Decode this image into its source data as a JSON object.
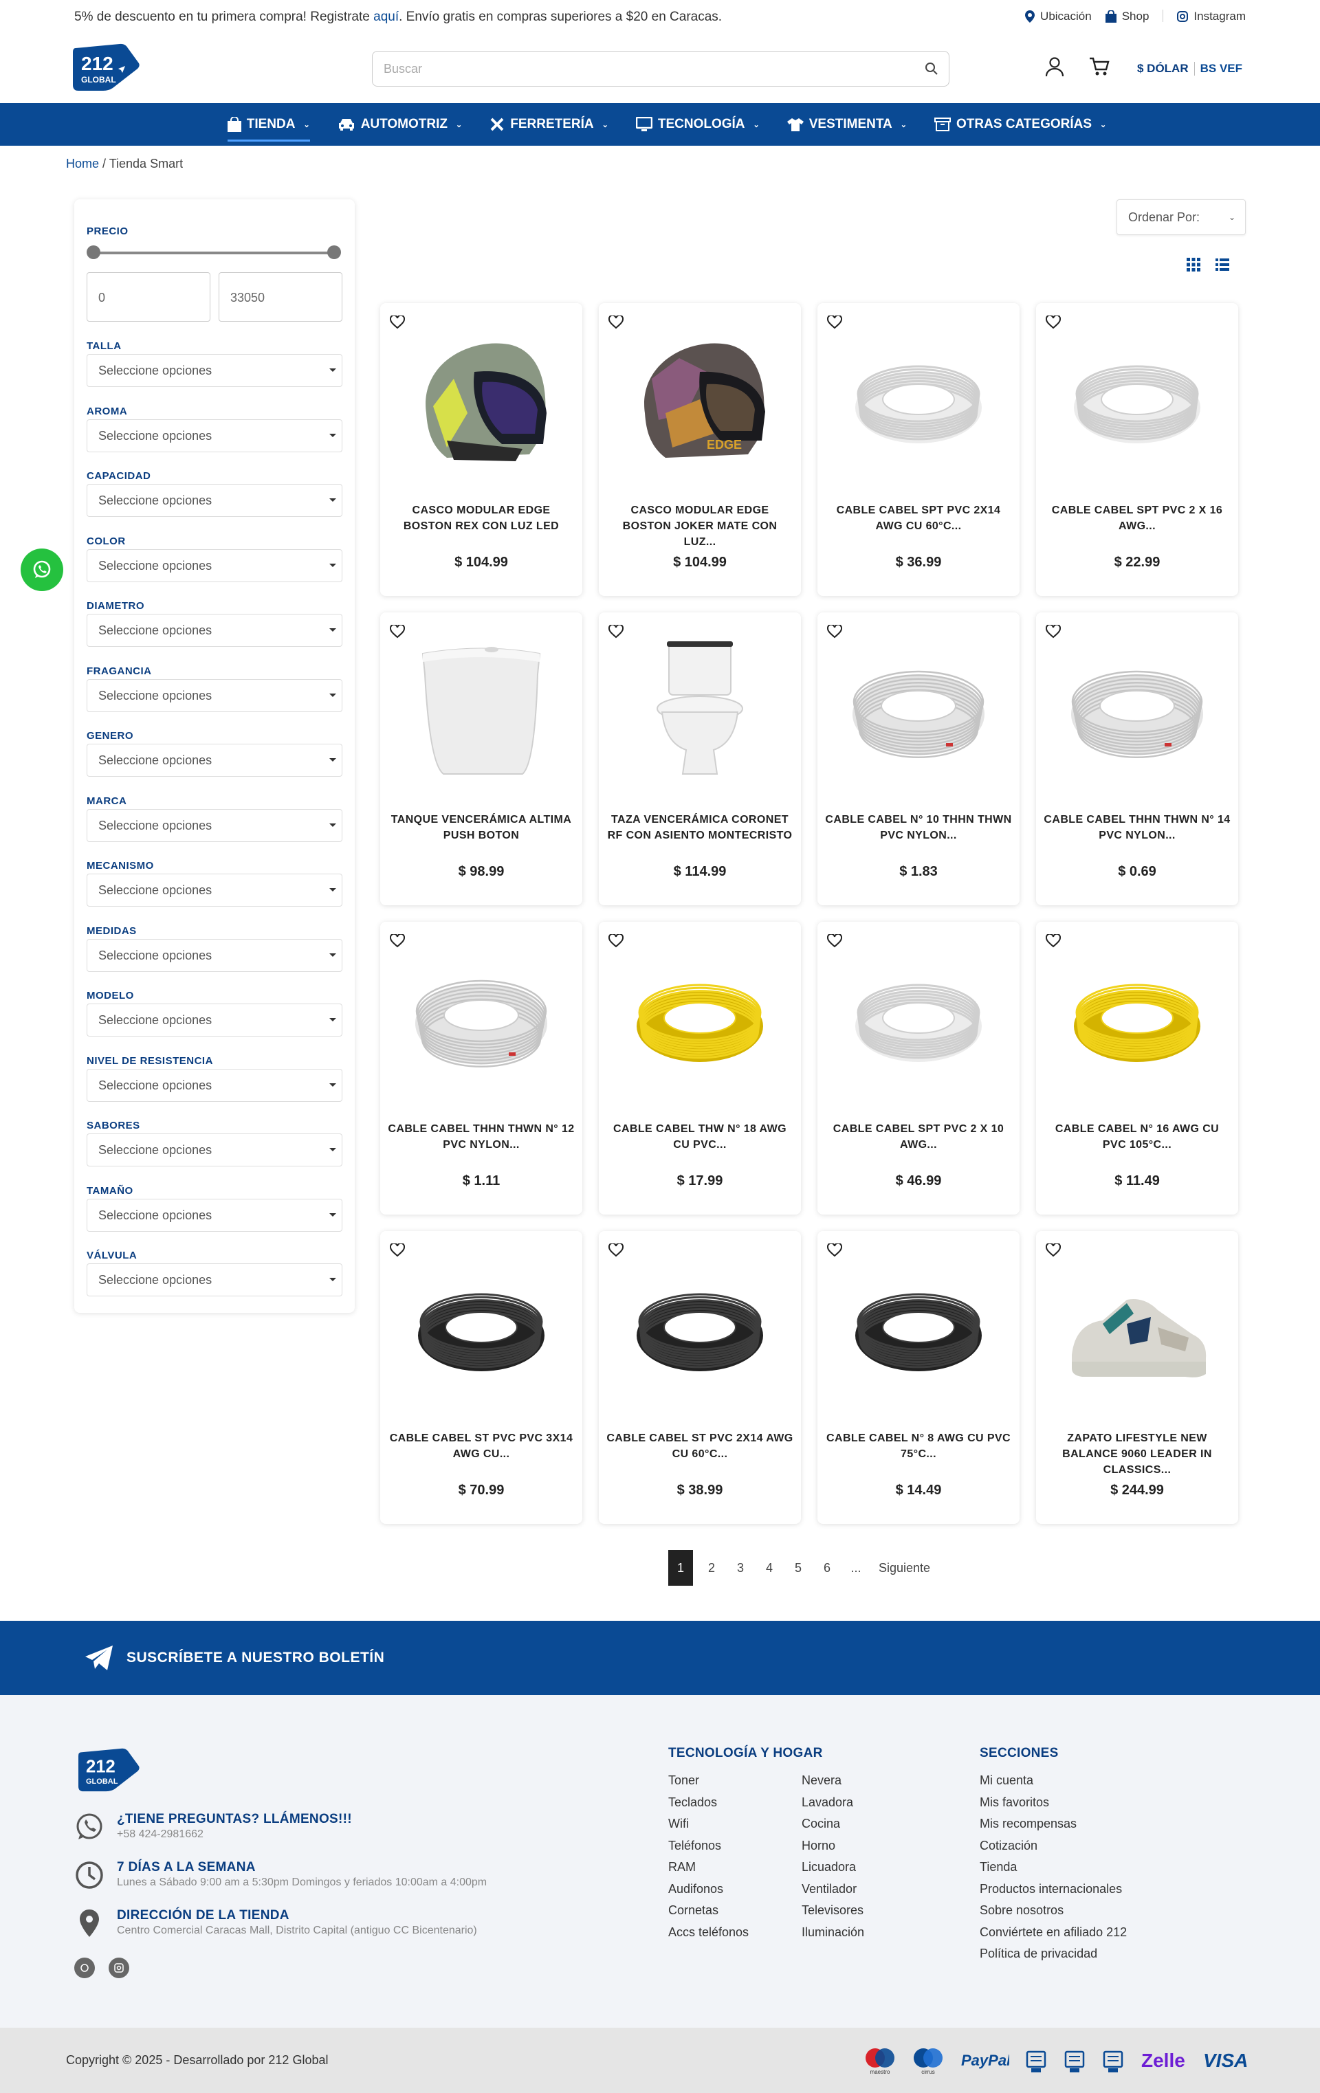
{
  "topbar": {
    "promo_before": "5% de descuento en tu primera compra! Registrate ",
    "promo_link": "aquí",
    "promo_after": ". Envío gratis en compras superiores a $20 en Caracas.",
    "links": [
      "Ubicación",
      "Shop",
      "Instagram"
    ]
  },
  "header": {
    "logo_text": "212",
    "logo_sub": "GLOBAL",
    "search_placeholder": "Buscar",
    "currency_active": "$ DÓLAR",
    "currency_alt": "BS VEF"
  },
  "nav": {
    "items": [
      "TIENDA",
      "AUTOMOTRIZ",
      "FERRETERÍA",
      "TECNOLOGÍA",
      "VESTIMENTA",
      "OTRAS CATEGORÍAS"
    ]
  },
  "breadcrumb": {
    "home": "Home",
    "sep": " / ",
    "current": "Tienda Smart"
  },
  "filters": {
    "price_title": "PRECIO",
    "price_min": "0",
    "price_max": "33050",
    "placeholder": "Seleccione opciones",
    "groups": [
      "TALLA",
      "AROMA",
      "CAPACIDAD",
      "COLOR",
      "DIAMETRO",
      "FRAGANCIA",
      "GENERO",
      "MARCA",
      "MECANISMO",
      "MEDIDAS",
      "MODELO",
      "NIVEL DE RESISTENCIA",
      "SABORES",
      "TAMAÑO",
      "VÁLVULA"
    ]
  },
  "sort": {
    "label": "Ordenar Por:"
  },
  "products": [
    {
      "name": "CASCO MODULAR EDGE BOSTON REX CON LUZ LED",
      "price": "$ 104.99",
      "img": "helmet-green"
    },
    {
      "name": "CASCO MODULAR EDGE BOSTON JOKER MATE CON LUZ...",
      "price": "$ 104.99",
      "img": "helmet-joker"
    },
    {
      "name": "CABLE CABEL SPT PVC 2X14 AWG CU 60°C...",
      "price": "$ 36.99",
      "img": "cable-white"
    },
    {
      "name": "CABLE CABEL SPT PVC 2 X 16 AWG...",
      "price": "$ 22.99",
      "img": "cable-white"
    },
    {
      "name": "TANQUE VENCERÁMICA ALTIMA PUSH BOTON",
      "price": "$ 98.99",
      "img": "tank"
    },
    {
      "name": "TAZA VENCERÁMICA CORONET RF CON ASIENTO MONTECRISTO",
      "price": "$ 114.99",
      "img": "toilet"
    },
    {
      "name": "CABLE CABEL N° 10 THHN THWN PVC NYLON...",
      "price": "$ 1.83",
      "img": "cable-flat"
    },
    {
      "name": "CABLE CABEL THHN THWN N° 14 PVC NYLON...",
      "price": "$ 0.69",
      "img": "cable-flat"
    },
    {
      "name": "CABLE CABEL THHN THWN N° 12 PVC NYLON...",
      "price": "$ 1.11",
      "img": "cable-flat"
    },
    {
      "name": "CABLE CABEL THW N° 18 AWG CU PVC...",
      "price": "$ 17.99",
      "img": "cable-yellow"
    },
    {
      "name": "CABLE CABEL SPT PVC 2 X 10 AWG...",
      "price": "$ 46.99",
      "img": "cable-white"
    },
    {
      "name": "CABLE CABEL N° 16 AWG CU PVC 105°C...",
      "price": "$ 11.49",
      "img": "cable-yellow"
    },
    {
      "name": "CABLE CABEL ST PVC PVC 3X14 AWG CU...",
      "price": "$ 70.99",
      "img": "cable-black"
    },
    {
      "name": "CABLE CABEL ST PVC 2X14 AWG CU 60°C...",
      "price": "$ 38.99",
      "img": "cable-black"
    },
    {
      "name": "CABLE CABEL N° 8 AWG CU PVC 75°C...",
      "price": "$ 14.49",
      "img": "cable-black"
    },
    {
      "name": "ZAPATO LIFESTYLE NEW BALANCE 9060 LEADER IN CLASSICS...",
      "price": "$ 244.99",
      "img": "shoe"
    }
  ],
  "pagination": {
    "pages": [
      "1",
      "2",
      "3",
      "4",
      "5",
      "6",
      "..."
    ],
    "next": "Siguiente"
  },
  "newsletter": {
    "text": "SUSCRÍBETE A NUESTRO BOLETÍN"
  },
  "footer": {
    "contact": [
      {
        "title": "¿TIENE PREGUNTAS? LLÁMENOS!!!",
        "sub": "+58 424-2981662"
      },
      {
        "title": "7 DÍAS A LA SEMANA",
        "sub": "Lunes a Sábado 9:00 am a 5:30pm Domingos y feriados 10:00am a 4:00pm"
      },
      {
        "title": "DIRECCIÓN DE LA TIENDA",
        "sub": "Centro Comercial Caracas Mall, Distrito Capital (antiguo CC Bicentenario)"
      }
    ],
    "tech_title": "TECNOLOGÍA Y HOGAR",
    "tech_col1": [
      "Toner",
      "Teclados",
      "Wifi",
      "Teléfonos",
      "RAM",
      "Audifonos",
      "Cornetas",
      "Accs teléfonos"
    ],
    "tech_col2": [
      "Nevera",
      "Lavadora",
      "Cocina",
      "Horno",
      "Licuadora",
      "Ventilador",
      "Televisores",
      "Iluminación"
    ],
    "sections_title": "SECCIONES",
    "sections": [
      "Mi cuenta",
      "Mis favoritos",
      "Mis recompensas",
      "Cotización",
      "Tienda",
      "Productos internacionales",
      "Sobre nosotros",
      "Conviértete en afiliado 212",
      "Política de privacidad"
    ]
  },
  "bottom": {
    "copyright": "Copyright © 2025 - Desarrollado por 212 Global",
    "payments": [
      {
        "name": "maestro",
        "label": "maestro"
      },
      {
        "name": "cirrus",
        "label": "cirrus"
      },
      {
        "name": "paypal",
        "label": "PayPal"
      },
      {
        "name": "bank1",
        "label": ""
      },
      {
        "name": "bank2",
        "label": ""
      },
      {
        "name": "bank3",
        "label": ""
      },
      {
        "name": "zelle",
        "label": "Zelle"
      },
      {
        "name": "visa",
        "label": "VISA"
      }
    ]
  },
  "colors": {
    "brand": "#0a4a94",
    "dark": "#0a3d80",
    "whatsapp": "#25c13f"
  }
}
